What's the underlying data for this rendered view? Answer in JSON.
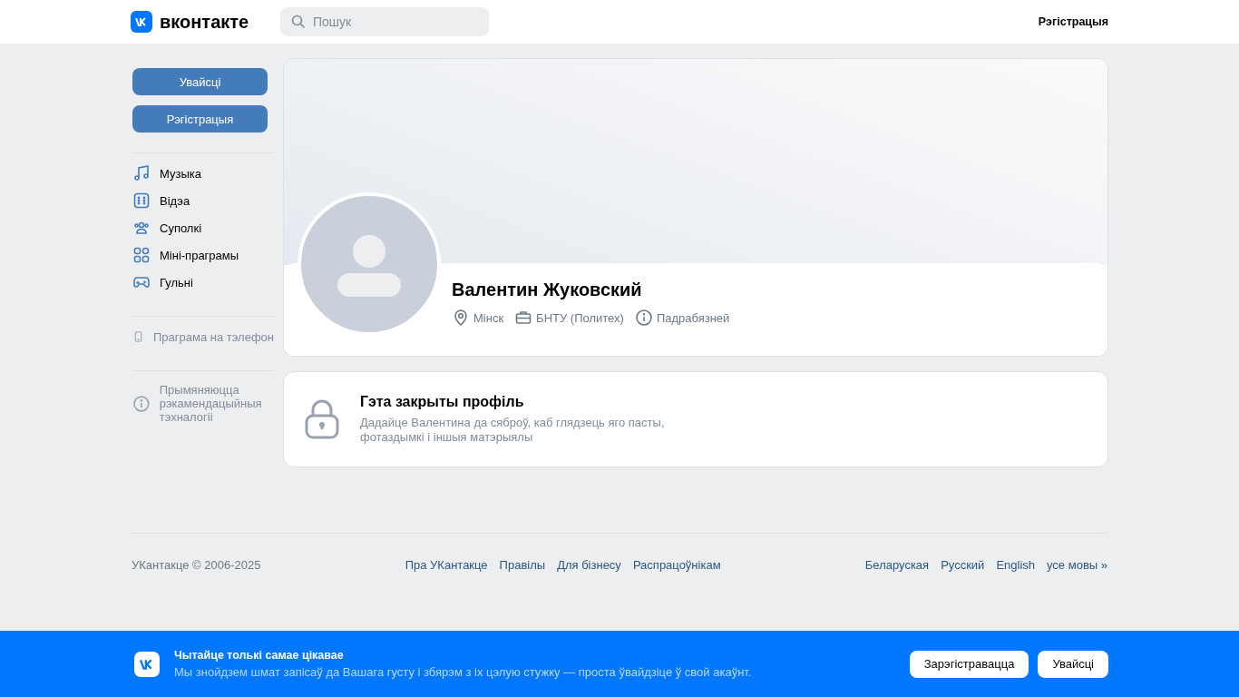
{
  "header": {
    "logo_text": "вконтакте",
    "search": {
      "placeholder": "Пошук"
    },
    "register_link": "Рэгістрацыя"
  },
  "sidebar": {
    "buttons": [
      "Увайсці",
      "Рэгістрацыя"
    ],
    "menu_items": [
      "Музыка",
      "Відэа",
      "Суполкі",
      "Міні-праграмы",
      "Гульні"
    ],
    "app_link": "Праграма на тэлефон",
    "recommendations_note": "Прымяняюцца рэкамендацыйныя тэхналогіі"
  },
  "profile": {
    "name": "Валентин Жуковский",
    "details": [
      "Мінск",
      "БНТУ (Политех)",
      "Падрабязней"
    ]
  },
  "closed_profile": {
    "title": "Гэта закрыты профіль",
    "text": "Дадайце Валентина да сяброў, каб глядзець яго пасты, фотаздымкі і іншыя матэрыялы"
  },
  "footer": {
    "copyright": "УКантакце © 2006-2025",
    "links": [
      "Пра УКантакце",
      "Правілы",
      "Для бізнесу",
      "Распрацоўнікам"
    ],
    "languages": [
      "Беларуская",
      "Русский",
      "English",
      "усе мовы »"
    ]
  },
  "banner": {
    "title": "Чытайце толькі самае цікавае",
    "text": "Мы знойдзем шмат запісаў да Вашага густу і збярэм з іх цэлую стужку — проста ўвайдзіце ў свой акаўнт.",
    "buttons": [
      "Зарэгістравацца",
      "Увайсці"
    ]
  }
}
